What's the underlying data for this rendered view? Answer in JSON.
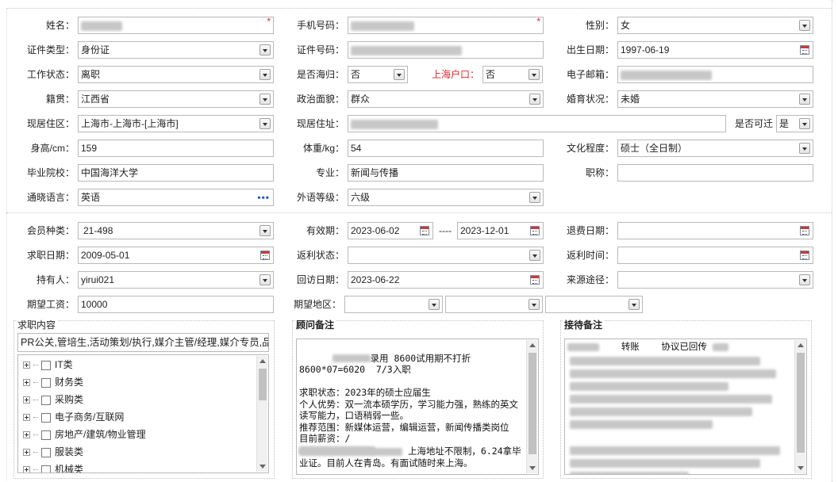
{
  "basic": {
    "name": {
      "label": "姓名：",
      "required": "*"
    },
    "phone": {
      "label": "手机号码：",
      "required": "*"
    },
    "gender": {
      "label": "性别：",
      "value": "女"
    },
    "id_type": {
      "label": "证件类型：",
      "value": "身份证"
    },
    "id_number": {
      "label": "证件号码："
    },
    "birth_date": {
      "label": "出生日期：",
      "value": "1997-06-19"
    },
    "work_status": {
      "label": "工作状态：",
      "value": "离职"
    },
    "returnee": {
      "label": "是否海归：",
      "value": "否"
    },
    "shanghai_hukou": {
      "label": "上海户口：",
      "value": "否"
    },
    "email": {
      "label": "电子邮箱："
    },
    "native_place": {
      "label": "籍贯：",
      "value": "江西省"
    },
    "political": {
      "label": "政治面貌：",
      "value": "群众"
    },
    "marital": {
      "label": "婚育状况：",
      "value": "未婚"
    },
    "residence_area": {
      "label": "现居住区：",
      "value": "上海市-上海市-[上海市]"
    },
    "address": {
      "label": "现居住址："
    },
    "relocate": {
      "label": "是否可迁",
      "value": "是"
    },
    "height": {
      "label": "身高/cm：",
      "value": "159"
    },
    "weight": {
      "label": "体重/kg：",
      "value": "54"
    },
    "education": {
      "label": "文化程度：",
      "value": "硕士（全日制）"
    },
    "school": {
      "label": "毕业院校：",
      "value": "中国海洋大学"
    },
    "major": {
      "label": "专业：",
      "value": "新闻与传播"
    },
    "title": {
      "label": "职称：",
      "value": ""
    },
    "language": {
      "label": "通晓语言：",
      "value": "英语",
      "more": "•••"
    },
    "foreign_level": {
      "label": "外语等级：",
      "value": "六级"
    }
  },
  "membership": {
    "member_type": {
      "label": "会员种类：",
      "value": "21-498"
    },
    "validity": {
      "label": "有效期：",
      "start": "2023-06-02",
      "sep": "----",
      "end": "2023-12-01"
    },
    "refund_date": {
      "label": "退费日期：",
      "value": ""
    },
    "job_date": {
      "label": "求职日期：",
      "value": "2009-05-01"
    },
    "rebate_status": {
      "label": "返利状态：",
      "value": ""
    },
    "rebate_time": {
      "label": "返利时间：",
      "value": ""
    },
    "holder": {
      "label": "持有人：",
      "value": "yirui021"
    },
    "revisit_date": {
      "label": "回访日期：",
      "value": "2023-06-22"
    },
    "source": {
      "label": "来源途径：",
      "value": ""
    },
    "expected_salary": {
      "label": "期望工资：",
      "value": "10000"
    },
    "expected_region": {
      "label": "期望地区："
    }
  },
  "job_content": {
    "title": "求职内容",
    "summary": "PR公关,管培生,活动策划/执行,媒介主管/经理,媒介专员,品",
    "tree": [
      "IT类",
      "财务类",
      "采购类",
      "电子商务/互联网",
      "房地产/建筑/物业管理",
      "服装类",
      "机械类"
    ]
  },
  "consultant_note": {
    "title": "顾问备注",
    "text": "录用 8600试用期不打折\n8600*07=6020  7/3入职\n\n求职状态：2023年的硕士应届生\n个人优势：双一流本硕学历，学习能力强，熟练的英文读写能力，口语稍弱一些。\n推荐范围：新媒体运营，编辑运营，新闻传播类岗位\n目前薪资：/\n",
    "tail": "上海地址不限制，6.24拿毕业证。目前人在青岛。有面试随时来上海。"
  },
  "reception_note": {
    "title": "接待备注",
    "line1": "转账    协议已回传"
  },
  "colors": {
    "required": "#e0262e",
    "border": "#b9b9b9",
    "accent": "#2860b6"
  }
}
